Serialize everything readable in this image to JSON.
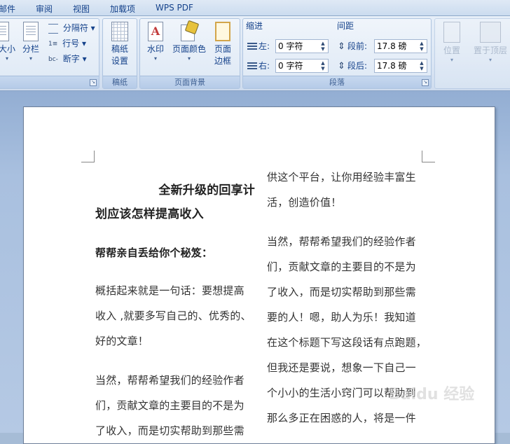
{
  "menu_tabs": [
    "邮件",
    "审阅",
    "视图",
    "加载项",
    "WPS PDF"
  ],
  "ribbon": {
    "page_setup": {
      "size_label": "大小",
      "columns_label": "分栏",
      "breaks_label": "分隔符",
      "line_numbers_label": "行号",
      "hyphenation_label": "断字"
    },
    "manuscript": {
      "settings_label": "稿纸设置",
      "group_label": "稿纸"
    },
    "page_background": {
      "watermark_label": "水印",
      "page_color_label": "页面颜色",
      "page_borders_label": "页面边框",
      "group_label": "页面背景"
    },
    "paragraph": {
      "indent_heading": "缩进",
      "spacing_heading": "间距",
      "indent_left_label": "左:",
      "indent_left_value": "0 字符",
      "indent_right_label": "右:",
      "indent_right_value": "0 字符",
      "spacing_before_label": "段前:",
      "spacing_before_value": "17.8 磅",
      "spacing_after_label": "段后:",
      "spacing_after_value": "17.8 磅",
      "group_label": "段落"
    },
    "arrange": {
      "position_label": "位置",
      "bring_front_label": "置于顶层"
    }
  },
  "document": {
    "left_column": {
      "title_line1": "全新升级的回享计",
      "title_line2": "划应该怎样提高收入",
      "subtitle": "帮帮亲自丢给你个秘笈：",
      "para1": [
        "概括起来就是一句话：要想提高",
        "收入 ,就要多写自己的、优秀的、",
        "好的文章！"
      ],
      "para2": [
        "当然，帮帮希望我们的经验作者",
        "们，贡献文章的主要目的不是为",
        "了收入，而是切实帮助到那些需"
      ]
    },
    "right_column": {
      "para0": [
        "供这个平台，让你用经验丰富生",
        "活，创造价值！"
      ],
      "para1": [
        "当然，帮帮希望我们的经验作者",
        "们，贡献文章的主要目的不是为",
        "了收入，而是切实帮助到那些需",
        "要的人！嗯，助人为乐！我知道",
        "在这个标题下写这段话有点跑题，",
        "但我还是要说，想象一下自己一",
        "个小小的生活小窍门可以帮助到",
        "那么多正在困惑的人，将是一件"
      ]
    }
  },
  "watermark_text": "Baidu 经验"
}
